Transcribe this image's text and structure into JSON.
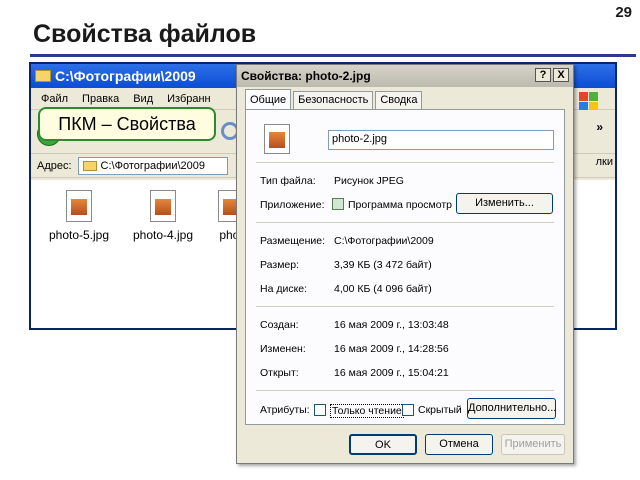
{
  "slide": {
    "title": "Свойства файлов",
    "number": "29"
  },
  "explorer": {
    "title": "C:\\Фотографии\\2009",
    "menu": [
      "Файл",
      "Правка",
      "Вид",
      "Избранн"
    ],
    "address_label": "Адрес:",
    "address_value": "C:\\Фотографии\\2009",
    "right_menu_fragment": "лки",
    "files": [
      {
        "name": "photo-5.jpg"
      },
      {
        "name": "photo-4.jpg"
      },
      {
        "name": "phot"
      }
    ]
  },
  "callout": {
    "text": "ПКМ – Свойства"
  },
  "dialog": {
    "title": "Свойства: photo-2.jpg",
    "tb_help": "?",
    "tb_close": "X",
    "tabs": [
      "Общие",
      "Безопасность",
      "Сводка"
    ],
    "file_name": "photo-2.jpg",
    "file_type_label": "Тип файла:",
    "file_type_value": "Рисунок JPEG",
    "app_label": "Приложение:",
    "app_value": "Программа просмотр",
    "change_button": "Изменить...",
    "location_label": "Размещение:",
    "location_value": "C:\\Фотографии\\2009",
    "size_label": "Размер:",
    "size_value": "3,39 КБ (3 472 байт)",
    "disk_label": "На диске:",
    "disk_value": "4,00 КБ (4 096 байт)",
    "created_label": "Создан:",
    "created_value": "16 мая 2009 г., 13:03:48",
    "modified_label": "Изменен:",
    "modified_value": "16 мая 2009 г., 14:28:56",
    "opened_label": "Открыт:",
    "opened_value": "16 мая 2009 г., 15:04:21",
    "attributes_label": "Атрибуты:",
    "readonly_label": "Только чтение",
    "hidden_label": "Скрытый",
    "advanced_button": "Дополнительно...",
    "ok_button": "OK",
    "cancel_button": "Отмена",
    "apply_button": "Применить"
  },
  "colors": {
    "accent_rule": "#2b3a8c",
    "xp_title": "#0b4dd4",
    "callout_border": "#2f8a2f"
  }
}
